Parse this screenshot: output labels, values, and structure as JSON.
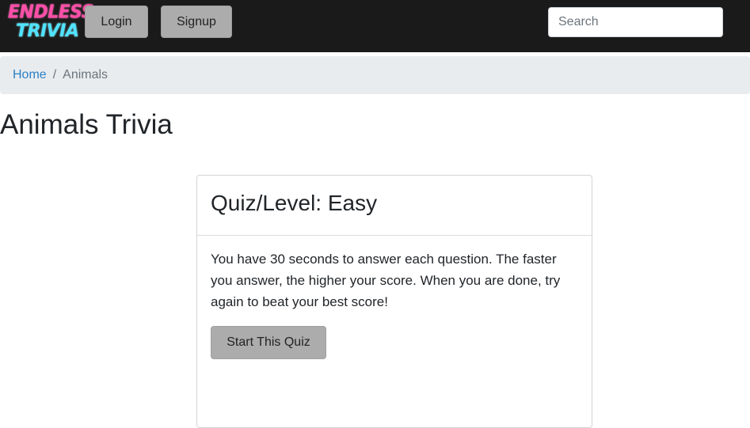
{
  "navbar": {
    "logo_line1": "ENDLESS",
    "logo_line2": "TRIVIA",
    "login_label": "Login",
    "signup_label": "Signup",
    "search_placeholder": "Search"
  },
  "breadcrumb": {
    "home_label": "Home",
    "separator": "/",
    "current_label": "Animals"
  },
  "page": {
    "title": "Animals Trivia"
  },
  "quiz_card": {
    "title": "Quiz/Level: Easy",
    "description": "You have 30 seconds to answer each question. The faster you answer, the higher your score. When you are done, try again to beat your best score!",
    "start_label": "Start This Quiz"
  },
  "colors": {
    "navbar_bg": "#1a1a1a",
    "logo_pink": "#ff4fa8",
    "logo_cyan": "#4fe3ff",
    "button_gray": "#acacac",
    "breadcrumb_bg": "#e9ecef",
    "link_blue": "#2a7fc5"
  }
}
